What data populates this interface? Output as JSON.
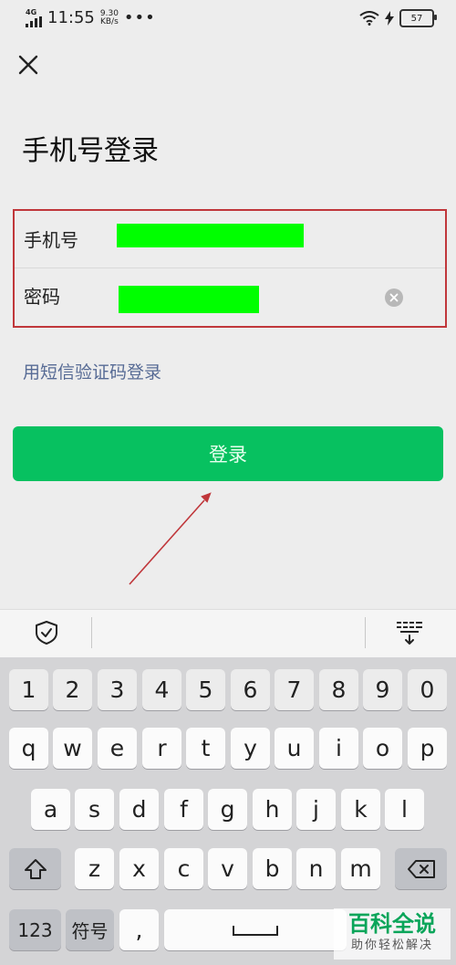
{
  "status_bar": {
    "network": "4G",
    "time": "11:55",
    "speed_value": "9.30",
    "speed_unit": "KB/s",
    "more": "•••",
    "battery": "57"
  },
  "page": {
    "title": "手机号登录"
  },
  "form": {
    "phone_label": "手机号",
    "password_label": "密码"
  },
  "sms_login_link": "用短信验证码登录",
  "login_button": "登录",
  "keyboard": {
    "number_row": [
      "1",
      "2",
      "3",
      "4",
      "5",
      "6",
      "7",
      "8",
      "9",
      "0"
    ],
    "row1": [
      "q",
      "w",
      "e",
      "r",
      "t",
      "y",
      "u",
      "i",
      "o",
      "p"
    ],
    "row2": [
      "a",
      "s",
      "d",
      "f",
      "g",
      "h",
      "j",
      "k",
      "l"
    ],
    "row3": [
      "z",
      "x",
      "c",
      "v",
      "b",
      "n",
      "m"
    ],
    "mode_123": "123",
    "symbols": "符号",
    "comma": ","
  },
  "watermark": {
    "title": "百科全说",
    "subtitle": "助你轻松解决"
  },
  "colors": {
    "accent_green": "#07c160",
    "link_blue": "#576b95",
    "highlight_red": "#c0373b",
    "redaction_green": "#00ff00"
  }
}
